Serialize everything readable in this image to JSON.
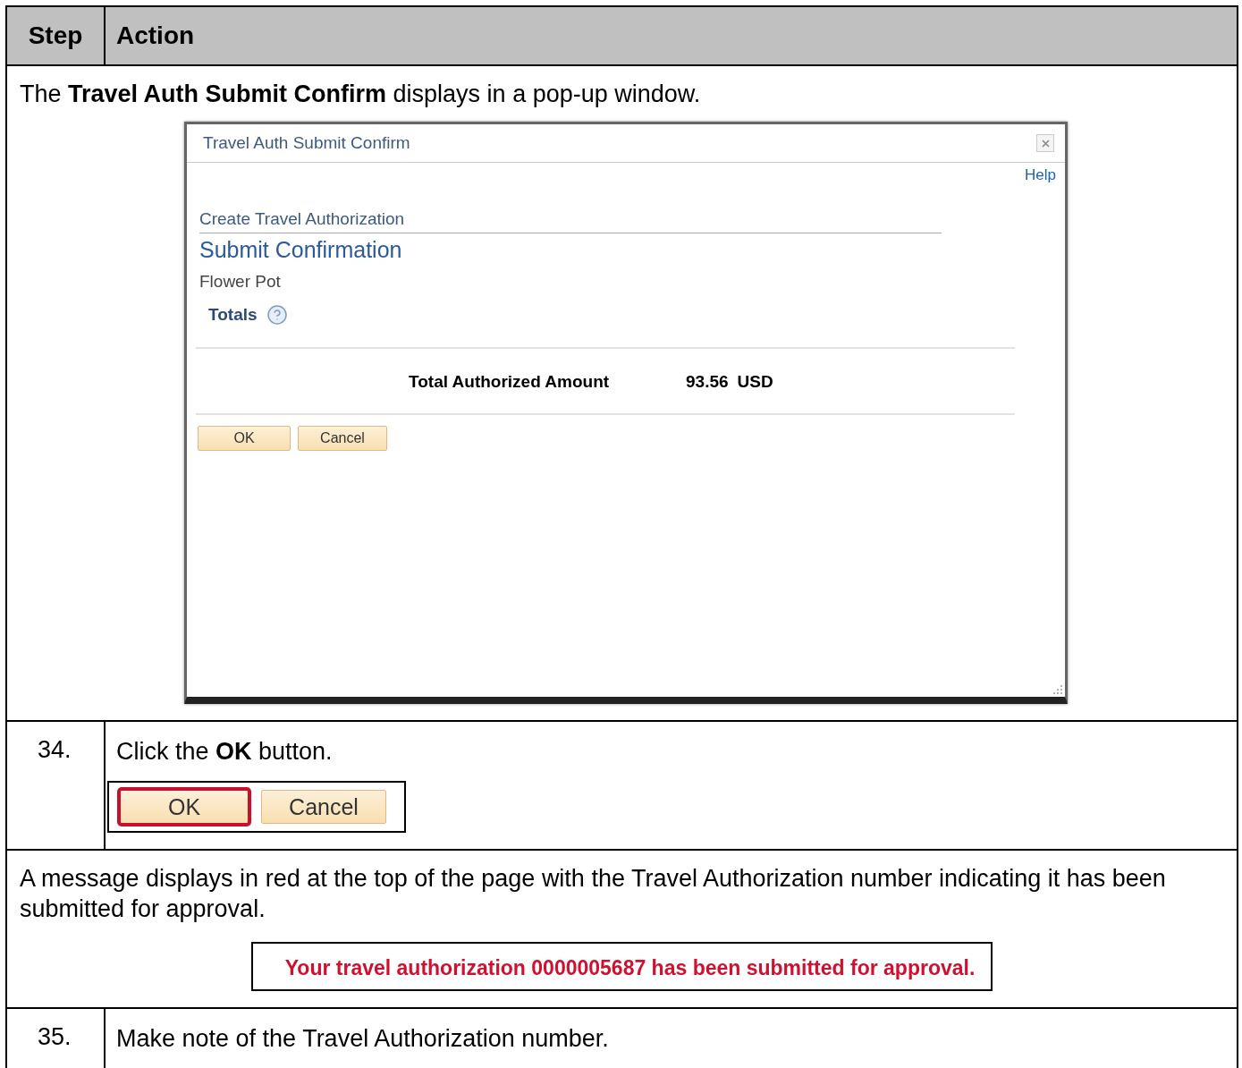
{
  "table": {
    "columns": [
      "Step",
      "Action"
    ],
    "rows": [
      {
        "kind": "note",
        "text": "The **Travel Auth Submit Confirm** displays in a pop-up window.",
        "popup": {
          "title": "Travel Auth Submit Confirm",
          "help": "Help",
          "breadcrumb": "Create Travel Authorization",
          "heading": "Submit Confirmation",
          "subtitle": "Flower Pot",
          "section": "Totals",
          "total_label": "Total Authorized Amount",
          "amount": "93.56",
          "currency": "USD",
          "buttons": [
            "OK",
            "Cancel"
          ]
        }
      },
      {
        "kind": "step",
        "step": "34.",
        "text": "Click the **OK** button.",
        "buttons": [
          {
            "label": "OK",
            "highlighted": true
          },
          {
            "label": "Cancel",
            "highlighted": false
          }
        ]
      },
      {
        "kind": "note",
        "text": "A message displays in red at the top of the page with the Travel Authorization number indicating it has been submitted for approval.",
        "message": "Your travel authorization 0000005687 has been submitted for approval."
      },
      {
        "kind": "step",
        "step": "35.",
        "text": "Make note of the Travel Authorization number."
      }
    ]
  }
}
